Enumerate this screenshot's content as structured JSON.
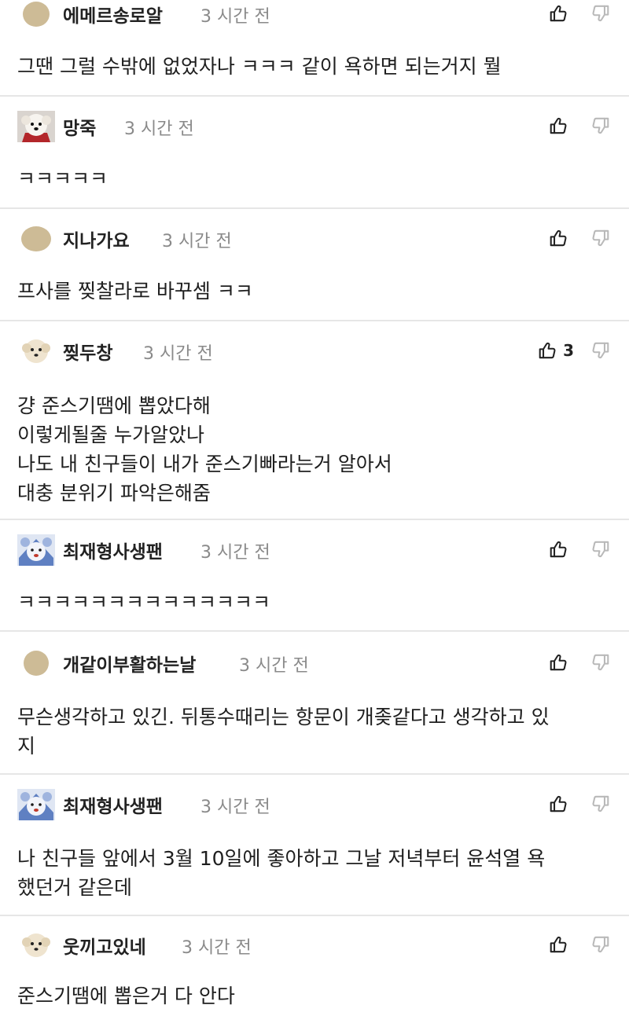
{
  "comments": [
    {
      "avatar": "plain-beige-avatar-icon",
      "author": "에메르송로알",
      "time": "3 시간 전",
      "text": "그땐 그럴 수밖에 없었자나 ㅋㅋㅋ 같이 욕하면 되는거지 뭘",
      "likes": ""
    },
    {
      "avatar": "white-dog-red-scarf-avatar-icon",
      "author": "망죽",
      "time": "3 시간 전",
      "text": "ㅋㅋㅋㅋㅋ",
      "likes": ""
    },
    {
      "avatar": "plain-beige-avatar-icon",
      "author": "지나가요",
      "time": "3 시간 전",
      "text": "프사를 찢찰라로 바꾸셈 ㅋㅋ",
      "likes": ""
    },
    {
      "avatar": "cream-dog-avatar-icon",
      "author": "찢두창",
      "time": "3 시간 전",
      "text": "걍 준스기땜에 뽑았다해\n이렇게될줄 누가알았나\n나도 내 친구들이 내가 준스기빠라는거 알아서\n대충 분위기 파악은해줌",
      "likes": "3"
    },
    {
      "avatar": "blue-bear-avatar-icon",
      "author": "최재형사생팬",
      "time": "3 시간 전",
      "text": "ㅋㅋㅋㅋㅋㅋㅋㅋㅋㅋㅋㅋㅋㅋ",
      "likes": ""
    },
    {
      "avatar": "plain-beige-avatar-icon",
      "author": "개같이부활하는날",
      "time": "3 시간 전",
      "text": "무슨생각하고 있긴. 뒤통수때리는 항문이 개좆같다고 생각하고 있\n지",
      "likes": ""
    },
    {
      "avatar": "blue-bear-avatar-icon",
      "author": "최재형사생팬",
      "time": "3 시간 전",
      "text": "나 친구들 앞에서 3월 10일에 좋아하고 그날 저녁부터 윤석열 욕\n했던거 같은데",
      "likes": ""
    },
    {
      "avatar": "cream-dog-avatar-icon",
      "author": "웃끼고있네",
      "time": "3 시간 전",
      "text": "준스기땜에 뽑은거 다 안다",
      "likes": ""
    }
  ],
  "icons": {
    "like": "thumbs-up-icon",
    "dislike": "thumbs-down-icon"
  }
}
